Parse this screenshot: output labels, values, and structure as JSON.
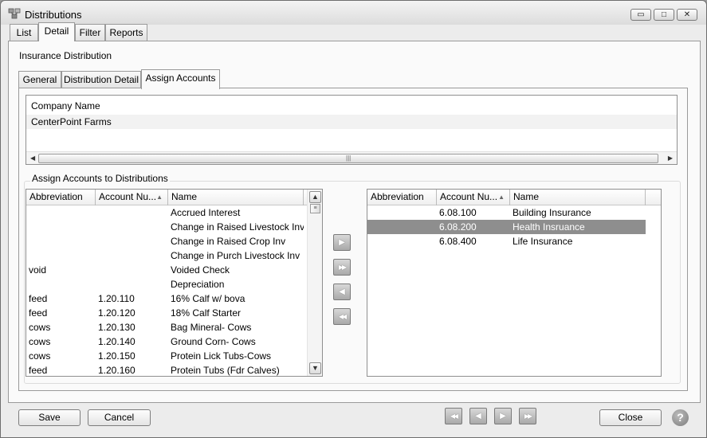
{
  "window": {
    "title": "Distributions",
    "controls": {
      "minimize": "▭",
      "maximize": "□",
      "close": "✕"
    }
  },
  "main_tabs": [
    {
      "label": "List"
    },
    {
      "label": "Detail",
      "active": true
    },
    {
      "label": "Filter"
    },
    {
      "label": "Reports"
    }
  ],
  "section_title": "Insurance Distribution",
  "sub_tabs": [
    {
      "label": "General"
    },
    {
      "label": "Distribution Detail"
    },
    {
      "label": "Assign Accounts",
      "active": true
    }
  ],
  "company_grid": {
    "header": "Company Name",
    "rows": [
      "CenterPoint Farms"
    ]
  },
  "assign_group_title": "Assign Accounts to Distributions",
  "left_grid": {
    "columns": [
      "Abbreviation",
      "Account Nu...",
      "Name"
    ],
    "rows": [
      {
        "abbr": "",
        "acct": "",
        "name": "Accrued Interest"
      },
      {
        "abbr": "",
        "acct": "",
        "name": "Change in Raised Livestock Inv"
      },
      {
        "abbr": "",
        "acct": "",
        "name": "Change in Raised Crop Inv"
      },
      {
        "abbr": "",
        "acct": "",
        "name": "Change in Purch Livestock Inv"
      },
      {
        "abbr": "void",
        "acct": "",
        "name": "Voided Check"
      },
      {
        "abbr": "",
        "acct": "",
        "name": "Depreciation"
      },
      {
        "abbr": "feed",
        "acct": "1.20.110",
        "name": "16% Calf w/ bova"
      },
      {
        "abbr": "feed",
        "acct": "1.20.120",
        "name": "18% Calf Starter"
      },
      {
        "abbr": "cows",
        "acct": "1.20.130",
        "name": "Bag Mineral- Cows"
      },
      {
        "abbr": "cows",
        "acct": "1.20.140",
        "name": "Ground Corn- Cows"
      },
      {
        "abbr": "cows",
        "acct": "1.20.150",
        "name": "Protein Lick Tubs-Cows"
      },
      {
        "abbr": "feed",
        "acct": "1.20.160",
        "name": "Protein Tubs (Fdr Calves)"
      }
    ]
  },
  "right_grid": {
    "columns": [
      "Abbreviation",
      "Account Nu...",
      "Name"
    ],
    "rows": [
      {
        "abbr": "",
        "acct": "6.08.100",
        "name": "Building Insurance"
      },
      {
        "abbr": "",
        "acct": "6.08.200",
        "name": "Health Insruance",
        "selected": true
      },
      {
        "abbr": "",
        "acct": "6.08.400",
        "name": "Life Insurance"
      }
    ]
  },
  "move_buttons": {
    "add_one": "▶",
    "add_all": "▶▶",
    "remove_one": "◀",
    "remove_all": "◀◀"
  },
  "footer": {
    "save": "Save",
    "cancel": "Cancel",
    "close": "Close",
    "help": "?",
    "nav": {
      "first": "◀◀",
      "prev": "◀",
      "next": "▶",
      "last": "▶▶"
    }
  }
}
